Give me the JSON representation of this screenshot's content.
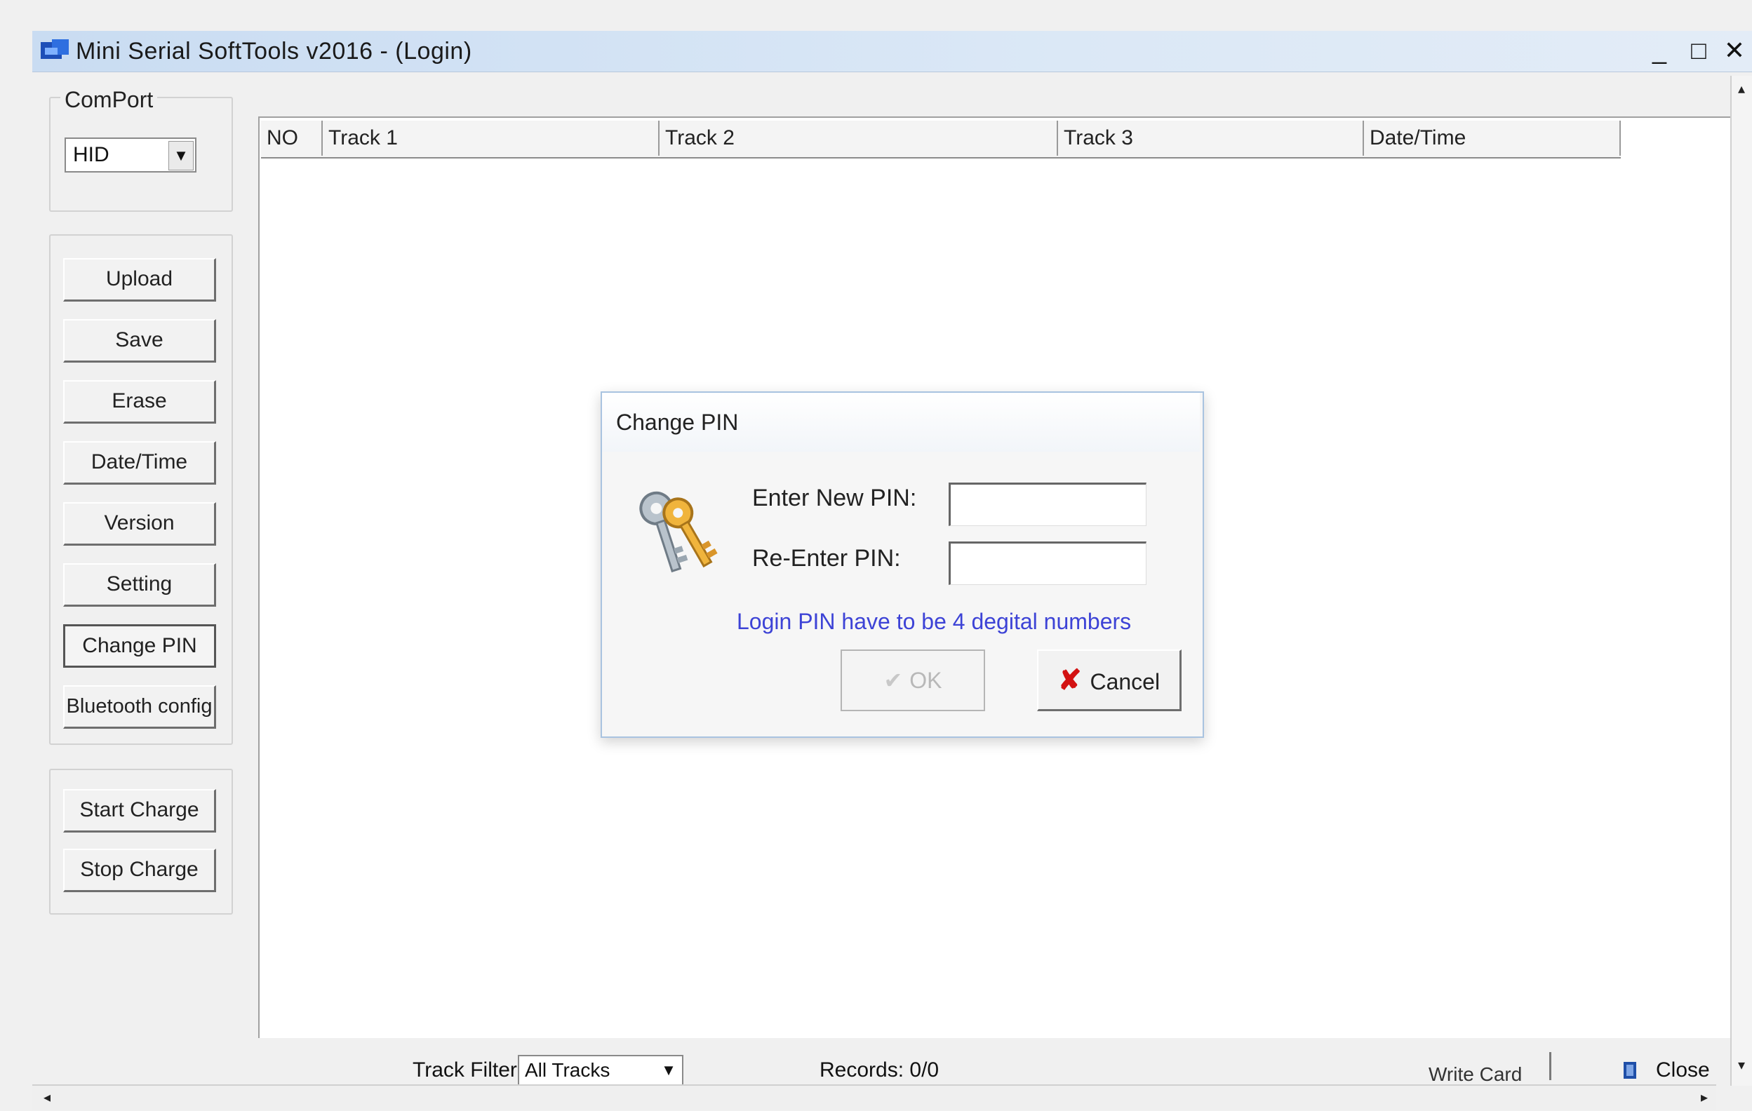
{
  "window": {
    "title": "Mini Serial SoftTools v2016 - (Login)",
    "controls": {
      "minimize": "_",
      "maximize": "□",
      "close": "✕"
    }
  },
  "comport": {
    "label": "ComPort",
    "selected": "HID",
    "arrow": "▼"
  },
  "actions": [
    "Upload",
    "Save",
    "Erase",
    "Date/Time",
    "Version",
    "Setting",
    "Change PIN",
    "Bluetooth config"
  ],
  "charge": [
    "Start Charge",
    "Stop Charge"
  ],
  "table": {
    "columns": [
      "NO",
      "Track 1",
      "Track 2",
      "Track 3",
      "Date/Time"
    ]
  },
  "dialog": {
    "title": "Change PIN",
    "new_pin_label": "Enter New PIN:",
    "re_pin_label": "Re-Enter PIN:",
    "new_pin_value": "",
    "re_pin_value": "",
    "hint": "Login PIN have to be 4 degital numbers",
    "ok_label": "OK",
    "cancel_label": "Cancel",
    "icon": "key-icon"
  },
  "status": {
    "track_filter_label": "Track Filter",
    "track_filter_value": "All Tracks",
    "records": "Records: 0/0",
    "write_card": "Write Card",
    "close_label": "Close"
  },
  "colors": {
    "hint": "#3d43d6",
    "cancel_x": "#d31212",
    "titlebar": "#c9dcf2"
  }
}
